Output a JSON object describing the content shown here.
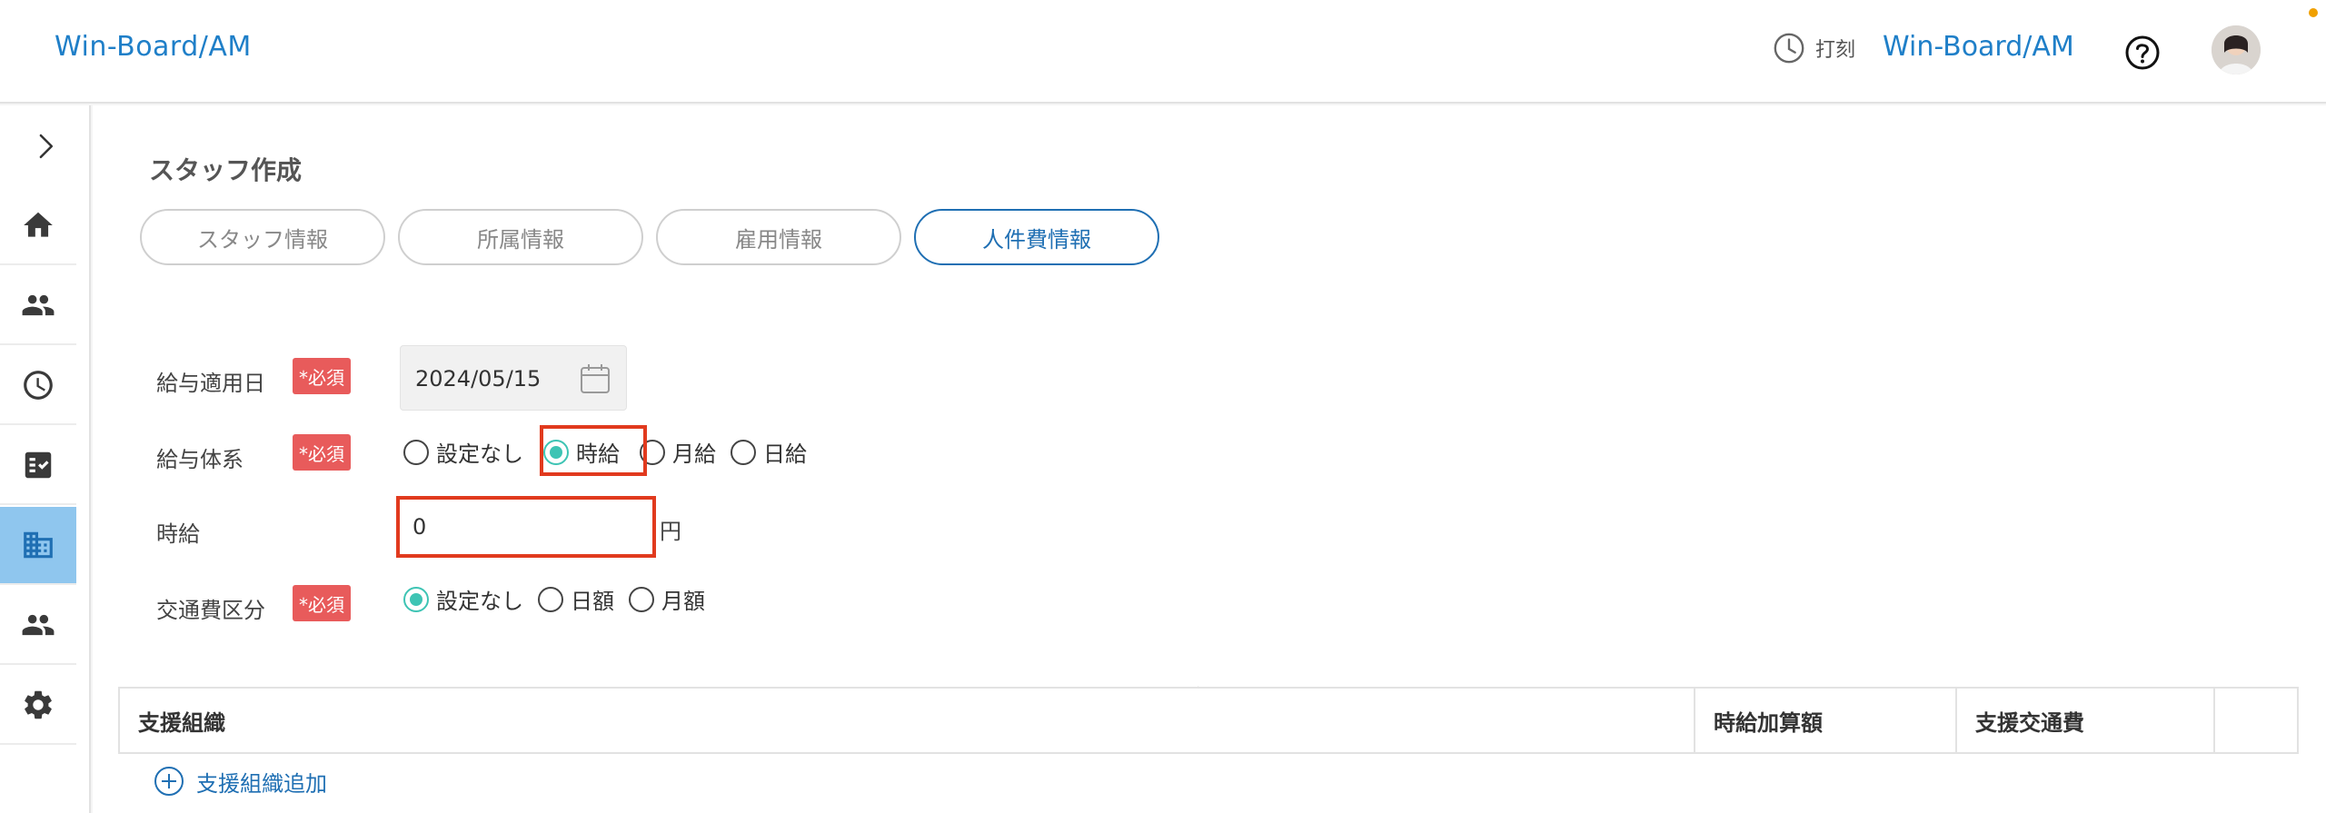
{
  "header": {
    "brand": "Win-Board/AM",
    "punch_label": "打刻",
    "user_brand": "Win-Board/AM"
  },
  "page": {
    "title": "スタッフ作成",
    "tabs": [
      {
        "label": "スタッフ情報",
        "active": false
      },
      {
        "label": "所属情報",
        "active": false
      },
      {
        "label": "雇用情報",
        "active": false
      },
      {
        "label": "人件費情報",
        "active": true
      }
    ]
  },
  "form": {
    "salary_date": {
      "label": "給与適用日",
      "required": "*必須",
      "value": "2024/05/15"
    },
    "salary_type": {
      "label": "給与体系",
      "required": "*必須",
      "options": [
        "設定なし",
        "時給",
        "月給",
        "日給"
      ],
      "selected": "時給"
    },
    "hourly_wage": {
      "label": "時給",
      "value": "0",
      "unit": "円"
    },
    "transport": {
      "label": "交通費区分",
      "required": "*必須",
      "options": [
        "設定なし",
        "日額",
        "月額"
      ],
      "selected": "設定なし"
    }
  },
  "support_table": {
    "columns": [
      "支援組織",
      "時給加算額",
      "支援交通費"
    ],
    "add_label": "支援組織追加"
  },
  "colors": {
    "brand_blue": "#1f7fc8",
    "required_red": "#e85b5b",
    "radio_teal": "#3ec4b4",
    "highlight_red": "#e13a1e",
    "sidebar_active": "#8fc6ee"
  },
  "sidebar": {
    "items": [
      {
        "icon": "home-icon"
      },
      {
        "icon": "people-icon"
      },
      {
        "icon": "clock-icon"
      },
      {
        "icon": "task-check-icon"
      },
      {
        "icon": "building-icon",
        "active": true
      },
      {
        "icon": "group-icon"
      },
      {
        "icon": "gear-icon"
      }
    ]
  }
}
